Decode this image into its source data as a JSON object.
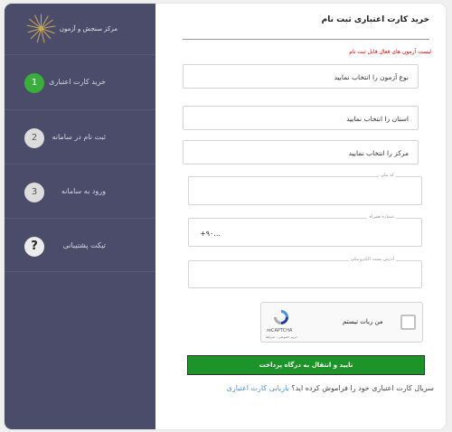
{
  "brand": {
    "name": "مرکز سنجش و آزمون",
    "logo_icon": "sunburst-logo"
  },
  "sidebar": {
    "steps": [
      {
        "number": "1",
        "label": "خرید کارت اعتباری",
        "state": "active"
      },
      {
        "number": "2",
        "label": "ثبت نام در سامانه",
        "state": "idle"
      },
      {
        "number": "3",
        "label": "ورود به سامانه",
        "state": "idle"
      },
      {
        "number": "?",
        "label": "تیکت پشتیبانی",
        "state": "help"
      }
    ]
  },
  "main": {
    "title": "خرید کارت اعتباری ثبت نام",
    "alert": "لیست آزمون های فعال قابل ثبت نام",
    "exam_select": "نوع آزمون را انتخاب نمایید",
    "province_select": "استان را انتخاب نمایید",
    "center_select": "مرکز را انتخاب نمایید",
    "national_code_label": "کد ملی",
    "mobile_label": "شماره همراه",
    "mobile_value": "+۹۰...",
    "email_label": "آدرس پست الکترونیکی"
  },
  "captcha": {
    "label": "من ربات نیستم",
    "brand": "reCAPTCHA",
    "links": "حریم خصوصی - شرایط"
  },
  "submit_label": "تایید و انتقال به درگاه پرداخت",
  "forgot": {
    "question": "سریال کارت اعتباری خود را فراموش کرده اید؟",
    "link": "بازیابی کارت اعتباری"
  },
  "colors": {
    "sidebar": "#4a4c69",
    "accent_green": "#3aae3c",
    "submit_green": "#1e9329",
    "alert_red": "#d40000",
    "link_blue": "#4a90d9"
  }
}
